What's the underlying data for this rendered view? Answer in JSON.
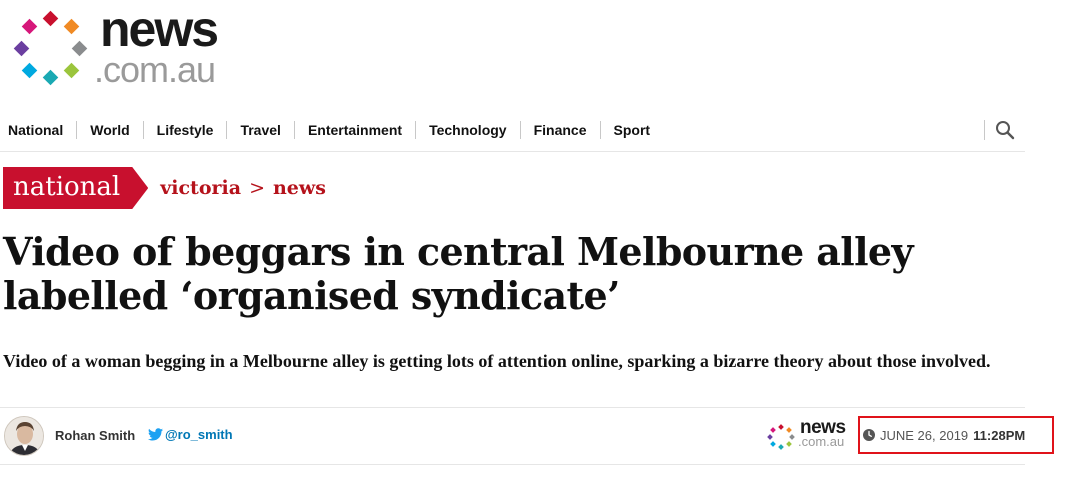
{
  "brand": {
    "name_top": "news",
    "name_bottom": ".com.au",
    "dot_colors": [
      "#c8102e",
      "#f08a24",
      "#8a8c8e",
      "#9bc53d",
      "#1aa9b3",
      "#00a9e0",
      "#6b3fa0",
      "#d6177a"
    ]
  },
  "nav": {
    "items": [
      "National",
      "World",
      "Lifestyle",
      "Travel",
      "Entertainment",
      "Technology",
      "Finance",
      "Sport"
    ],
    "search_icon": "search-icon"
  },
  "section": {
    "tag": "national",
    "breadcrumbs": [
      "victoria",
      "news"
    ],
    "separator": ">"
  },
  "article": {
    "headline": "Video of beggars in central Melbourne alley labelled ‘organised syndicate’",
    "standfirst": "Video of a woman begging in a Melbourne alley is getting lots of attention online, sparking a bizarre theory about those involved.",
    "author": "Rohan Smith",
    "twitter_handle": "@ro_smith",
    "date": "JUNE 26, 2019",
    "time": "11:28PM"
  },
  "colors": {
    "accent": "#c8102e",
    "breadcrumb": "#b5121b",
    "twitter": "#0077b5",
    "highlight_box": "#e0131a"
  }
}
